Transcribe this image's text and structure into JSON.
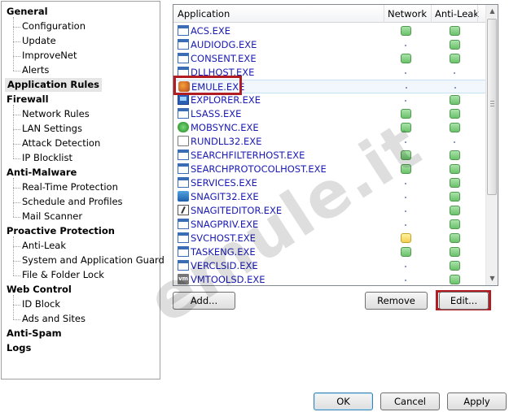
{
  "tree": {
    "categories": [
      {
        "label": "General",
        "children": [
          "Configuration",
          "Update",
          "ImproveNet",
          "Alerts"
        ]
      },
      {
        "label": "Application Rules",
        "children": [],
        "selected": true
      },
      {
        "label": "Firewall",
        "children": [
          "Network Rules",
          "LAN Settings",
          "Attack Detection",
          "IP Blocklist"
        ]
      },
      {
        "label": "Anti-Malware",
        "children": [
          "Real-Time Protection",
          "Schedule and Profiles",
          "Mail Scanner"
        ]
      },
      {
        "label": "Proactive Protection",
        "children": [
          "Anti-Leak",
          "System and Application Guard",
          "File & Folder Lock"
        ]
      },
      {
        "label": "Web Control",
        "children": [
          "ID Block",
          "Ads and Sites"
        ]
      },
      {
        "label": "Anti-Spam",
        "children": []
      },
      {
        "label": "Logs",
        "children": []
      }
    ]
  },
  "list": {
    "columns": [
      "Application",
      "Network",
      "Anti-Leak"
    ],
    "rows": [
      {
        "name": "ACS.EXE",
        "icon": "exe-icon",
        "network": "green",
        "antileak": "green"
      },
      {
        "name": "AUDIODG.EXE",
        "icon": "exe-icon",
        "network": "dot",
        "antileak": "green"
      },
      {
        "name": "CONSENT.EXE",
        "icon": "exe-icon",
        "network": "green",
        "antileak": "green"
      },
      {
        "name": "DLLHOST.EXE",
        "icon": "exe-icon",
        "network": "dot",
        "antileak": "dot"
      },
      {
        "name": "EMULE.EXE",
        "icon": "emule-icon",
        "network": "dot",
        "antileak": "dot",
        "selected": true
      },
      {
        "name": "EXPLORER.EXE",
        "icon": "explorer-icon",
        "network": "dot",
        "antileak": "green"
      },
      {
        "name": "LSASS.EXE",
        "icon": "exe-icon",
        "network": "green",
        "antileak": "green"
      },
      {
        "name": "MOBSYNC.EXE",
        "icon": "sync-icon",
        "network": "green",
        "antileak": "green"
      },
      {
        "name": "RUNDLL32.EXE",
        "icon": "document-icon",
        "network": "dot",
        "antileak": "dot"
      },
      {
        "name": "SEARCHFILTERHOST.EXE",
        "icon": "exe-icon",
        "network": "green",
        "antileak": "green"
      },
      {
        "name": "SEARCHPROTOCOLHOST.EXE",
        "icon": "exe-icon",
        "network": "green",
        "antileak": "green"
      },
      {
        "name": "SERVICES.EXE",
        "icon": "exe-icon",
        "network": "dot",
        "antileak": "green"
      },
      {
        "name": "SNAGIT32.EXE",
        "icon": "snagit-icon",
        "network": "dot",
        "antileak": "green"
      },
      {
        "name": "SNAGITEDITOR.EXE",
        "icon": "snagit-editor-icon",
        "network": "dot",
        "antileak": "green"
      },
      {
        "name": "SNAGPRIV.EXE",
        "icon": "exe-icon",
        "network": "dot",
        "antileak": "green"
      },
      {
        "name": "SVCHOST.EXE",
        "icon": "exe-icon",
        "network": "yellow",
        "antileak": "green"
      },
      {
        "name": "TASKENG.EXE",
        "icon": "exe-icon",
        "network": "green",
        "antileak": "green"
      },
      {
        "name": "VERCLSID.EXE",
        "icon": "exe-icon",
        "network": "dot",
        "antileak": "green"
      },
      {
        "name": "VMTOOLSD.EXE",
        "icon": "vm-icon",
        "network": "dot",
        "antileak": "green"
      }
    ]
  },
  "buttons": {
    "add": "Add...",
    "remove": "Remove",
    "edit": "Edit...",
    "ok": "OK",
    "cancel": "Cancel",
    "apply": "Apply"
  },
  "watermark": "emule.it",
  "colors": {
    "highlight": "#b01e24",
    "status_green": "#6cc16c",
    "status_yellow": "#f2d050",
    "link": "#1a1ab4"
  }
}
